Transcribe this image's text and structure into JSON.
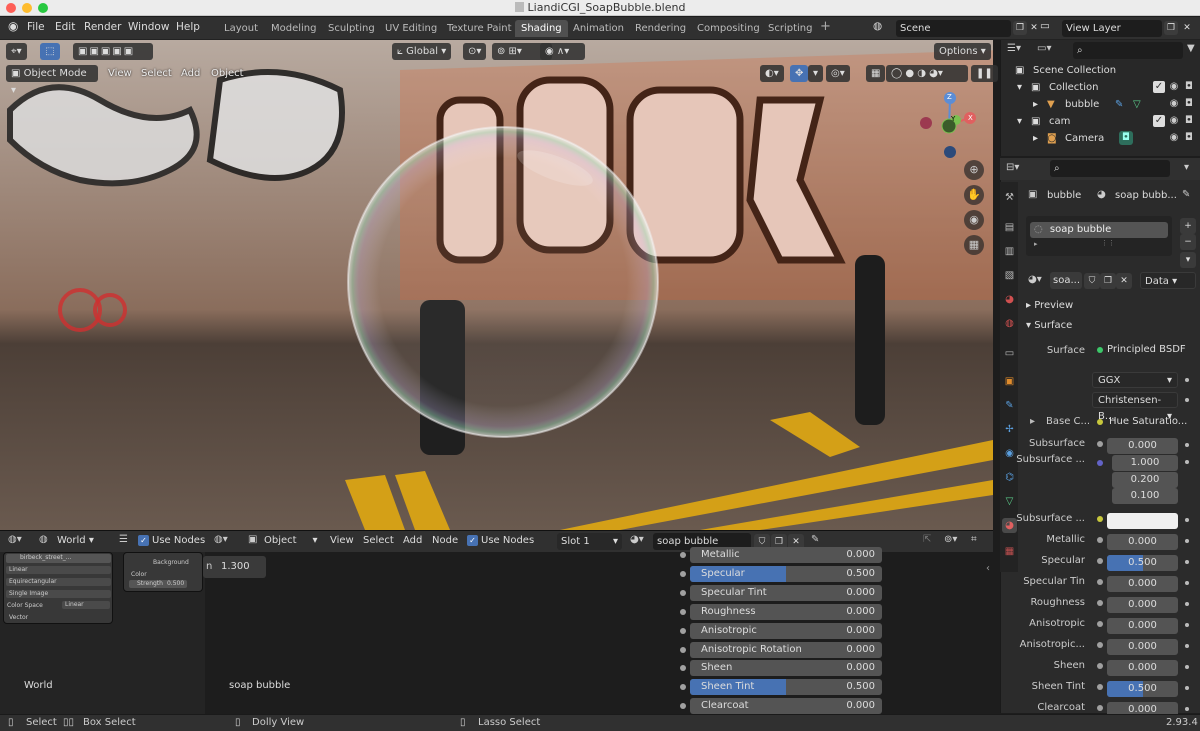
{
  "window": {
    "title": "LiandiCGI_SoapBubble.blend"
  },
  "menus": [
    "File",
    "Edit",
    "Render",
    "Window",
    "Help"
  ],
  "workspaces": [
    {
      "label": "Layout",
      "active": false
    },
    {
      "label": "Modeling",
      "active": false
    },
    {
      "label": "Sculpting",
      "active": false
    },
    {
      "label": "UV Editing",
      "active": false
    },
    {
      "label": "Texture Paint",
      "active": false
    },
    {
      "label": "Shading",
      "active": true
    },
    {
      "label": "Animation",
      "active": false
    },
    {
      "label": "Rendering",
      "active": false
    },
    {
      "label": "Compositing",
      "active": false
    },
    {
      "label": "Scripting",
      "active": false
    }
  ],
  "scene": {
    "name": "Scene"
  },
  "view_layer": {
    "name": "View Layer"
  },
  "viewport": {
    "transform_orientation": "Global",
    "options_label": "Options",
    "mode": "Object Mode",
    "menus": [
      "View",
      "Select",
      "Add",
      "Object"
    ],
    "gizmo_axes": {
      "z": "Z",
      "y": "Y",
      "x": "X"
    }
  },
  "outliner": {
    "scene_collection": "Scene Collection",
    "items": [
      {
        "label": "Collection"
      },
      {
        "label": "bubble"
      },
      {
        "label": "cam"
      },
      {
        "label": "Camera"
      }
    ]
  },
  "properties": {
    "object": "bubble",
    "material_breadcrumb": "soap bubb...",
    "material_slot": "soap bubble",
    "material_short": "soa...",
    "link": "Data",
    "panels": {
      "preview": "Preview",
      "surface": "Surface"
    },
    "surface_label": "Surface",
    "surface_shader": "Principled BSDF",
    "distribution": "GGX",
    "subsurface_method": "Christensen-B...",
    "base_color_label": "Base C...",
    "base_color_input": "Hue Saturatio...",
    "rows": [
      {
        "label": "Subsurface",
        "value": "0.000",
        "fill": 0
      },
      {
        "label": "Subsurface ...",
        "values": [
          "1.000",
          "0.200",
          "0.100"
        ]
      },
      {
        "label": "Subsurface ...",
        "color": "#f0f0f0"
      },
      {
        "label": "Metallic",
        "value": "0.000",
        "fill": 0
      },
      {
        "label": "Specular",
        "value": "0.500",
        "fill": 0.5
      },
      {
        "label": "Specular Tin",
        "value": "0.000",
        "fill": 0
      },
      {
        "label": "Roughness",
        "value": "0.000",
        "fill": 0
      },
      {
        "label": "Anisotropic",
        "value": "0.000",
        "fill": 0
      },
      {
        "label": "Anisotropic...",
        "value": "0.000",
        "fill": 0
      },
      {
        "label": "Sheen",
        "value": "0.000",
        "fill": 0
      },
      {
        "label": "Sheen Tint",
        "value": "0.500",
        "fill": 0.5
      },
      {
        "label": "Clearcoat",
        "value": "0.000",
        "fill": 0
      }
    ]
  },
  "world_editor": {
    "type": "World",
    "use_nodes": "Use Nodes",
    "env_image": "birbeck_street_...",
    "interpolation": "Linear",
    "projection": "Equirectangular",
    "source": "Single Image",
    "color_space_label": "Color Space",
    "color_space": "Linear",
    "vector": "Vector",
    "background_label": "Background",
    "color_label": "Color",
    "strength": "Strength",
    "strength_value": "0.500",
    "ior_prefix": "n",
    "ior_value": "1.300",
    "footer": "World"
  },
  "shader_editor": {
    "object_type": "Object",
    "menus": [
      "View",
      "Select",
      "Add",
      "Node"
    ],
    "use_nodes": "Use Nodes",
    "slot": "Slot 1",
    "material": "soap bubble",
    "footer": "soap bubble",
    "rows": [
      {
        "label": "Metallic",
        "value": "0.000",
        "fill": 0
      },
      {
        "label": "Specular",
        "value": "0.500",
        "fill": 0.5
      },
      {
        "label": "Specular Tint",
        "value": "0.000",
        "fill": 0
      },
      {
        "label": "Roughness",
        "value": "0.000",
        "fill": 0
      },
      {
        "label": "Anisotropic",
        "value": "0.000",
        "fill": 0
      },
      {
        "label": "Anisotropic Rotation",
        "value": "0.000",
        "fill": 0
      },
      {
        "label": "Sheen",
        "value": "0.000",
        "fill": 0
      },
      {
        "label": "Sheen Tint",
        "value": "0.500",
        "fill": 0.5
      },
      {
        "label": "Clearcoat",
        "value": "0.000",
        "fill": 0
      }
    ]
  },
  "statusbar": {
    "select": "Select",
    "box_select": "Box Select",
    "dolly": "Dolly View",
    "lasso": "Lasso Select",
    "version": "2.93.4"
  }
}
